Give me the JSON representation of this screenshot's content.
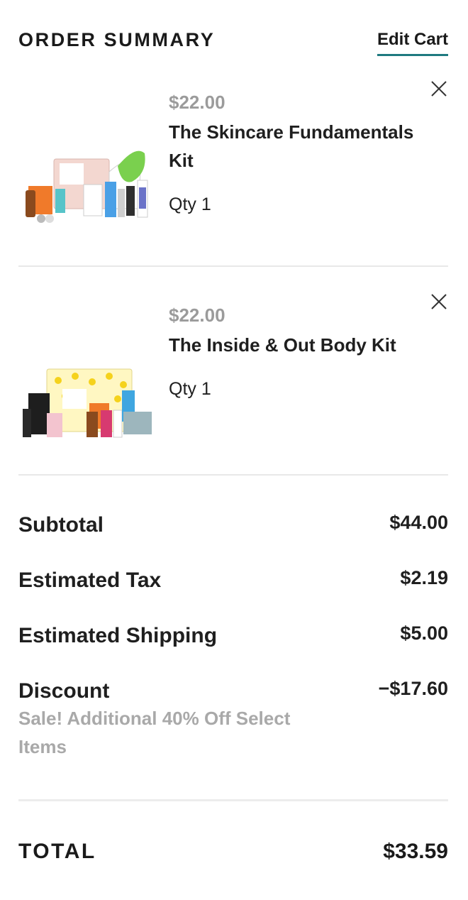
{
  "header": {
    "title": "ORDER SUMMARY",
    "edit_label": "Edit Cart"
  },
  "items": [
    {
      "price": "$22.00",
      "name": "The Skincare Fundamentals Kit",
      "qty": "Qty 1",
      "icon": "close-icon"
    },
    {
      "price": "$22.00",
      "name": "The Inside & Out Body Kit",
      "qty": "Qty 1",
      "icon": "close-icon"
    }
  ],
  "summary": {
    "subtotal": {
      "label": "Subtotal",
      "value": "$44.00"
    },
    "tax": {
      "label": "Estimated Tax",
      "value": "$2.19"
    },
    "shipping": {
      "label": "Estimated Shipping",
      "value": "$5.00"
    },
    "discount": {
      "label": "Discount",
      "value": "−$17.60",
      "note": "Sale! Additional 40% Off Select Items"
    }
  },
  "total": {
    "label": "TOTAL",
    "value": "$33.59"
  },
  "colors": {
    "accent_underline": "#1f7a80",
    "muted_text": "#9b9b9b",
    "divider": "#e8e8e8"
  }
}
